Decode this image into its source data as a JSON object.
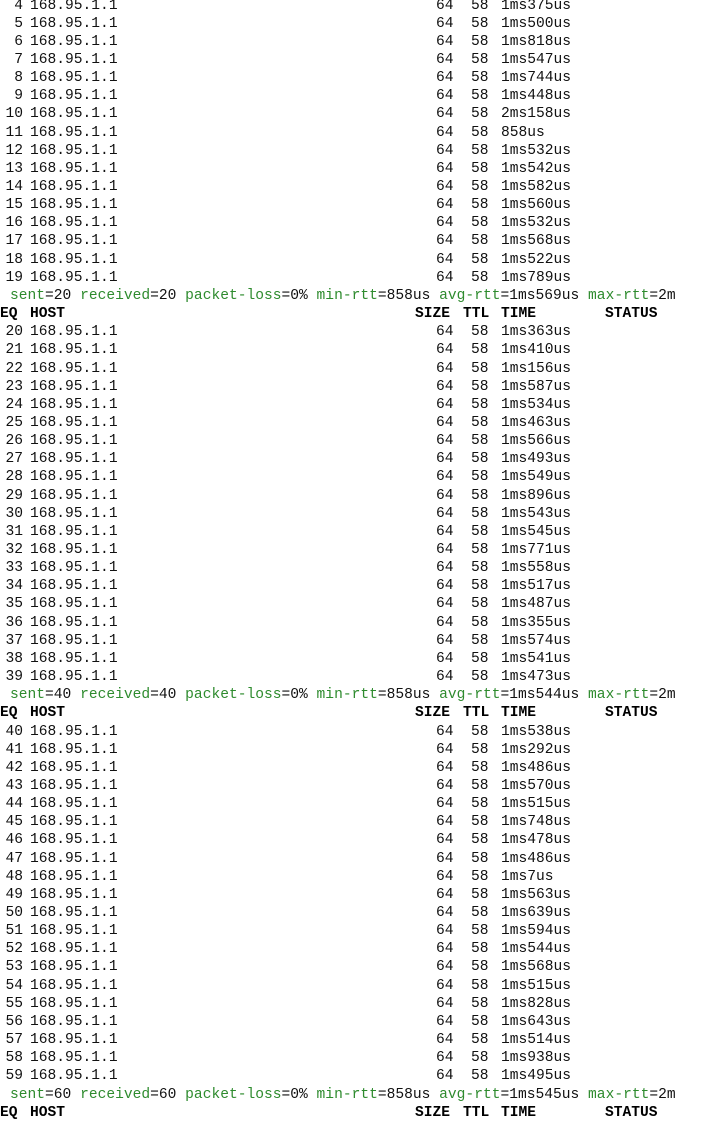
{
  "host": "168.95.1.1",
  "size": "64",
  "ttl": "58",
  "header": {
    "seq": "EQ",
    "host": "HOST",
    "size": "SIZE",
    "ttl": "TTL",
    "time": "TIME",
    "status": "STATUS"
  },
  "blocks": [
    {
      "rows": [
        {
          "seq": "4",
          "time": "1ms375us"
        },
        {
          "seq": "5",
          "time": "1ms500us"
        },
        {
          "seq": "6",
          "time": "1ms818us"
        },
        {
          "seq": "7",
          "time": "1ms547us"
        },
        {
          "seq": "8",
          "time": "1ms744us"
        },
        {
          "seq": "9",
          "time": "1ms448us"
        },
        {
          "seq": "10",
          "time": "2ms158us"
        },
        {
          "seq": "11",
          "time": "858us"
        },
        {
          "seq": "12",
          "time": "1ms532us"
        },
        {
          "seq": "13",
          "time": "1ms542us"
        },
        {
          "seq": "14",
          "time": "1ms582us"
        },
        {
          "seq": "15",
          "time": "1ms560us"
        },
        {
          "seq": "16",
          "time": "1ms532us"
        },
        {
          "seq": "17",
          "time": "1ms568us"
        },
        {
          "seq": "18",
          "time": "1ms522us"
        },
        {
          "seq": "19",
          "time": "1ms789us"
        }
      ],
      "summary": {
        "sent": "20",
        "received": "20",
        "packet_loss": "0%",
        "min_rtt": "858us",
        "avg_rtt": "1ms569us",
        "max_rtt": "2m"
      }
    },
    {
      "rows": [
        {
          "seq": "20",
          "time": "1ms363us"
        },
        {
          "seq": "21",
          "time": "1ms410us"
        },
        {
          "seq": "22",
          "time": "1ms156us"
        },
        {
          "seq": "23",
          "time": "1ms587us"
        },
        {
          "seq": "24",
          "time": "1ms534us"
        },
        {
          "seq": "25",
          "time": "1ms463us"
        },
        {
          "seq": "26",
          "time": "1ms566us"
        },
        {
          "seq": "27",
          "time": "1ms493us"
        },
        {
          "seq": "28",
          "time": "1ms549us"
        },
        {
          "seq": "29",
          "time": "1ms896us"
        },
        {
          "seq": "30",
          "time": "1ms543us"
        },
        {
          "seq": "31",
          "time": "1ms545us"
        },
        {
          "seq": "32",
          "time": "1ms771us"
        },
        {
          "seq": "33",
          "time": "1ms558us"
        },
        {
          "seq": "34",
          "time": "1ms517us"
        },
        {
          "seq": "35",
          "time": "1ms487us"
        },
        {
          "seq": "36",
          "time": "1ms355us"
        },
        {
          "seq": "37",
          "time": "1ms574us"
        },
        {
          "seq": "38",
          "time": "1ms541us"
        },
        {
          "seq": "39",
          "time": "1ms473us"
        }
      ],
      "summary": {
        "sent": "40",
        "received": "40",
        "packet_loss": "0%",
        "min_rtt": "858us",
        "avg_rtt": "1ms544us",
        "max_rtt": "2m"
      }
    },
    {
      "rows": [
        {
          "seq": "40",
          "time": "1ms538us"
        },
        {
          "seq": "41",
          "time": "1ms292us"
        },
        {
          "seq": "42",
          "time": "1ms486us"
        },
        {
          "seq": "43",
          "time": "1ms570us"
        },
        {
          "seq": "44",
          "time": "1ms515us"
        },
        {
          "seq": "45",
          "time": "1ms748us"
        },
        {
          "seq": "46",
          "time": "1ms478us"
        },
        {
          "seq": "47",
          "time": "1ms486us"
        },
        {
          "seq": "48",
          "time": "1ms7us"
        },
        {
          "seq": "49",
          "time": "1ms563us"
        },
        {
          "seq": "50",
          "time": "1ms639us"
        },
        {
          "seq": "51",
          "time": "1ms594us"
        },
        {
          "seq": "52",
          "time": "1ms544us"
        },
        {
          "seq": "53",
          "time": "1ms568us"
        },
        {
          "seq": "54",
          "time": "1ms515us"
        },
        {
          "seq": "55",
          "time": "1ms828us"
        },
        {
          "seq": "56",
          "time": "1ms643us"
        },
        {
          "seq": "57",
          "time": "1ms514us"
        },
        {
          "seq": "58",
          "time": "1ms938us"
        },
        {
          "seq": "59",
          "time": "1ms495us"
        }
      ],
      "summary": {
        "sent": "60",
        "received": "60",
        "packet_loss": "0%",
        "min_rtt": "858us",
        "avg_rtt": "1ms545us",
        "max_rtt": "2m"
      }
    }
  ],
  "colors": {
    "summary_key": "#2e8b2e",
    "text": "#111111",
    "background": "#ffffff"
  }
}
